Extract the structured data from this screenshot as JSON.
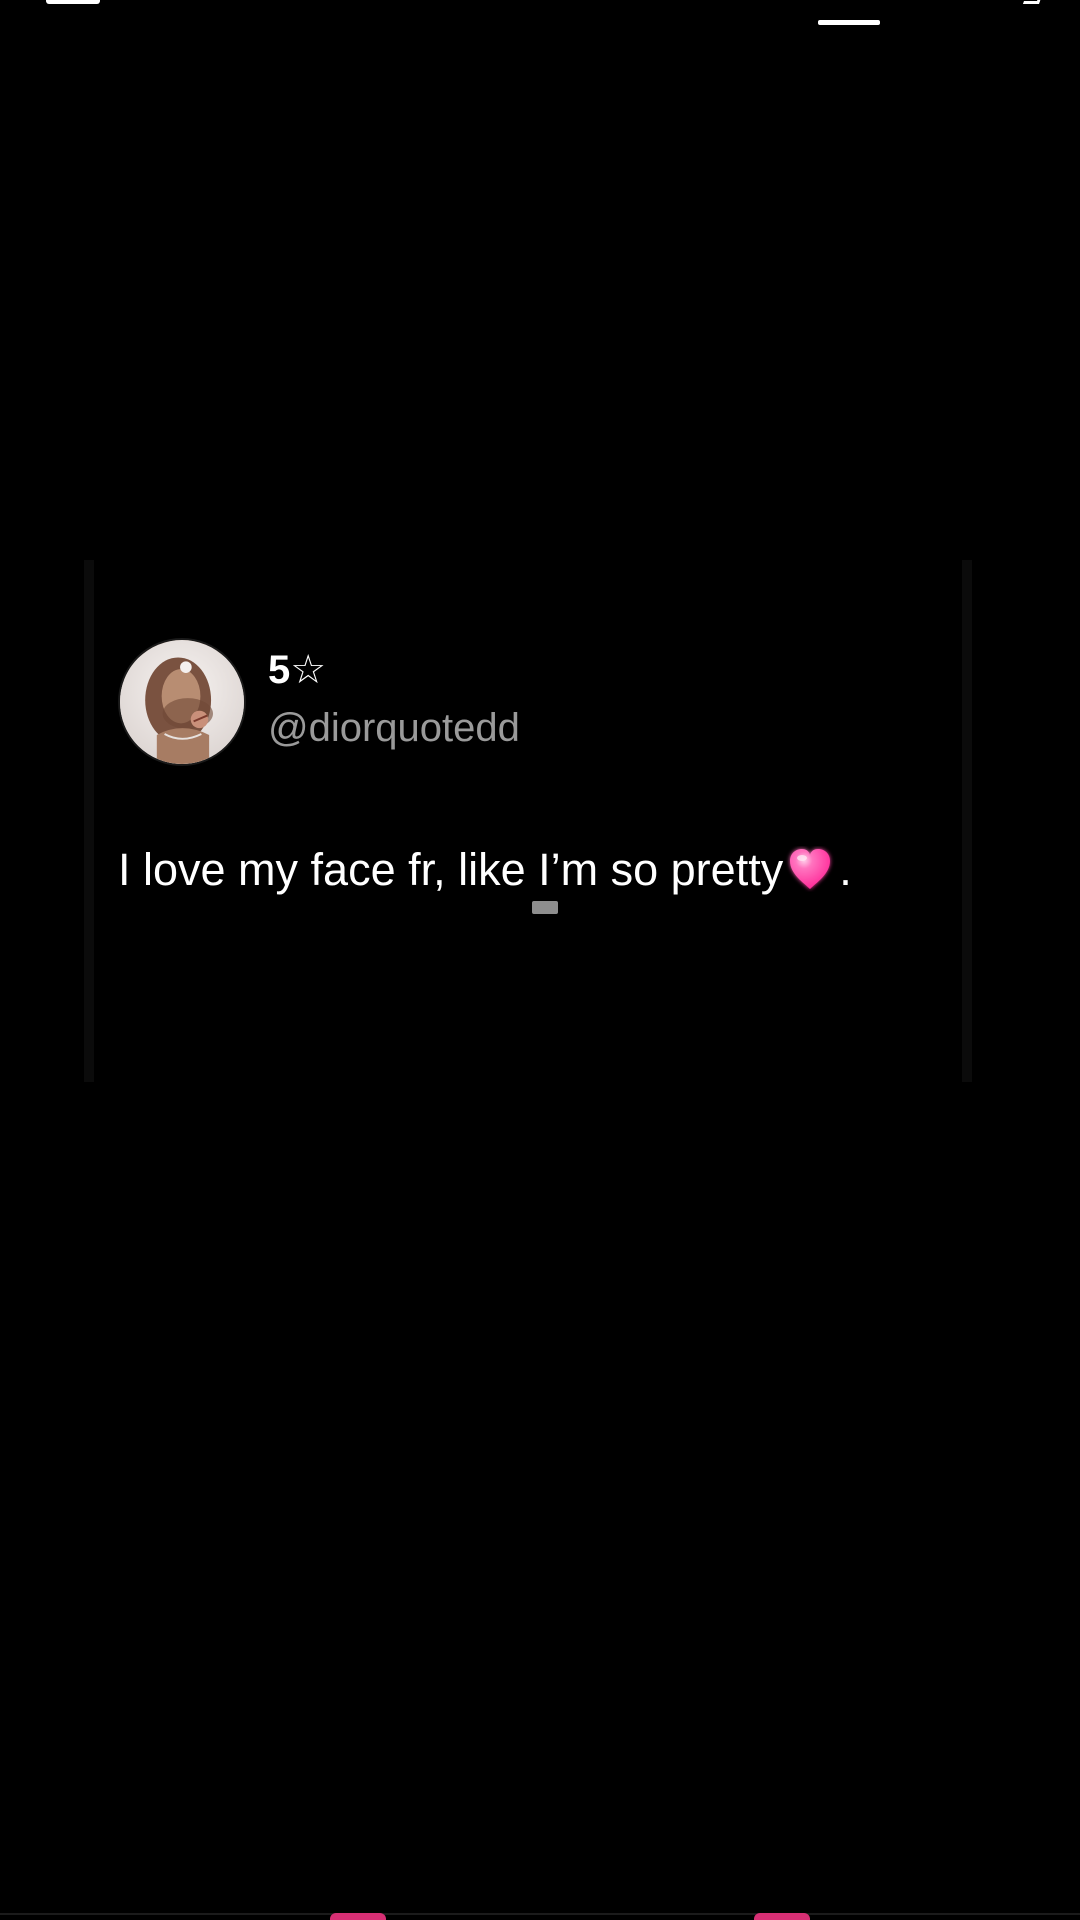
{
  "post": {
    "display_name": "5☆",
    "handle": "@diorquotedd",
    "text_main": "I love my face fr, like I’m so pretty",
    "emoji": "pink-heart",
    "period": "."
  },
  "colors": {
    "background": "#000000",
    "text_primary": "#ffffff",
    "text_secondary": "#9a9a9a",
    "heart_pink": "#ff4fa8",
    "accent_pink": "#d72f74"
  }
}
